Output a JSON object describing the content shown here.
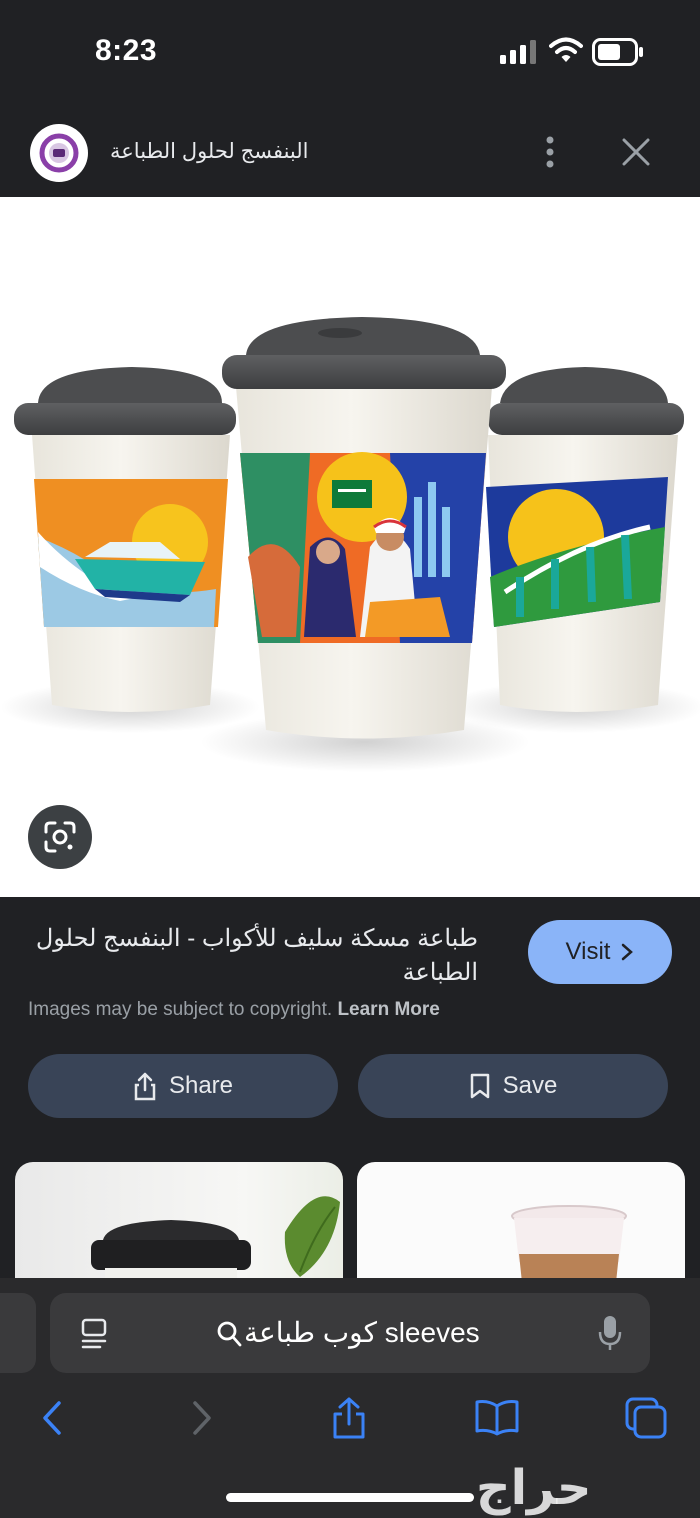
{
  "status_bar": {
    "time": "8:23"
  },
  "header": {
    "site_name": "البنفسج لحلول الطباعة"
  },
  "result": {
    "title": "طباعة مسكة سليف للأكواب - البنفسج لحلول الطباعة",
    "visit_label": "Visit",
    "copyright_text": "Images may be subject to copyright.",
    "learn_more_label": "Learn More"
  },
  "actions": {
    "share_label": "Share",
    "save_label": "Save"
  },
  "search": {
    "query": "كوب طباعة sleeves"
  },
  "watermark": "حراج",
  "colors": {
    "accent": "#8ab4f8",
    "pill_bg": "#394457",
    "background": "#202124"
  },
  "icons": [
    "site-logo",
    "more-vert-icon",
    "close-icon",
    "google-lens-icon",
    "chevron-right-icon",
    "share-icon",
    "bookmark-icon",
    "reader-icon",
    "search-icon",
    "mic-icon",
    "back-icon",
    "forward-icon",
    "share-tool-icon",
    "bookmarks-icon",
    "tabs-icon"
  ]
}
